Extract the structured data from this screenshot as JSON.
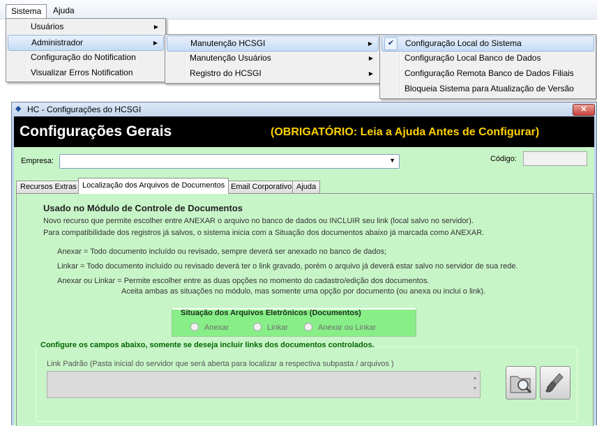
{
  "menubar": {
    "items": [
      "Sistema",
      "Ajuda"
    ]
  },
  "menu_sistema": [
    {
      "label": "Usuários",
      "submenu": true
    },
    {
      "label": "Administrador",
      "submenu": true,
      "highlighted": true
    },
    {
      "label": "Configuração do Notification",
      "submenu": false
    },
    {
      "label": "Visualizar Erros Notification",
      "submenu": false
    }
  ],
  "menu_admin": [
    {
      "label": "Manutenção HCSGI",
      "submenu": true,
      "highlighted": true
    },
    {
      "label": "Manutenção Usuários",
      "submenu": true
    },
    {
      "label": "Registro do HCSGI",
      "submenu": true
    }
  ],
  "menu_manut": [
    {
      "label": "Configuração Local do Sistema",
      "checked": true,
      "highlighted": true
    },
    {
      "label": "Configuração Local Banco de Dados"
    },
    {
      "label": "Configuração Remota Banco de Dados Filiais"
    },
    {
      "label": "Bloqueia Sistema para Atualização de Versão"
    }
  ],
  "window": {
    "title": "HC - Configurações do HCSGI",
    "close_symbol": "✕",
    "header_title": "Configurações Gerais",
    "header_warning": "(OBRIGATÓRIO: Leia a Ajuda Antes de Configurar)"
  },
  "form": {
    "empresa_label": "Empresa:",
    "empresa_value": "",
    "codigo_label": "Código:",
    "codigo_value": ""
  },
  "tabs": [
    {
      "label": "Recursos Extras"
    },
    {
      "label": "Localização dos Arquivos de Documentos",
      "active": true
    },
    {
      "label": "Email Corporativo"
    },
    {
      "label": "Ajuda"
    }
  ],
  "content": {
    "title": "Usado no Módulo de Controle de Documentos",
    "intro1": "Novo recurso que permite escolher entre ANEXAR o arquivo no banco de dados ou INCLUIR seu link (local salvo no servidor).",
    "intro2": "Para compatibilidade dos registros já salvos, o sistema inicia com a Situação dos documentos abaixo já marcada como ANEXAR.",
    "anexar": "Anexar = Todo documento incluído ou revisado, sempre deverá ser anexado no banco de dados;",
    "linkar": "Linkar = Todo documento incluído ou revisado deverá ter o link gravado, porém o arquivo já deverá estar salvo no servidor de sua rede.",
    "ou1": "Anexar ou Linkar = Permite escolher entre as duas opções no momento do cadastro/edição dos documentos.",
    "ou2": "Aceita ambas as situações no módulo, mas somente uma opção por documento (ou anexa ou inclui o link)."
  },
  "situacao": {
    "title": "Situação dos Arquivos Eletrônicos (Documentos)",
    "options": [
      "Anexar",
      "Linkar",
      "Anexar ou Linkar"
    ]
  },
  "links": {
    "title": "Configure os campos abaixo, somente se deseja incluir links dos documentos controlados.",
    "label": "Link Padrão (Pasta inicial do servidor que será aberta para localizar a respectiva subpasta / arquivos )",
    "value": ""
  },
  "colors": {
    "panel_bg": "#c8f5c8",
    "group_bg": "#88ee88",
    "header_bg": "#000000",
    "warning": "#ffd200",
    "links_title": "#006600"
  },
  "icons": [
    "chevron-right-icon",
    "check-icon",
    "close-icon",
    "window-app-icon",
    "chevron-down-icon",
    "folder-search-icon",
    "brush-icon"
  ]
}
